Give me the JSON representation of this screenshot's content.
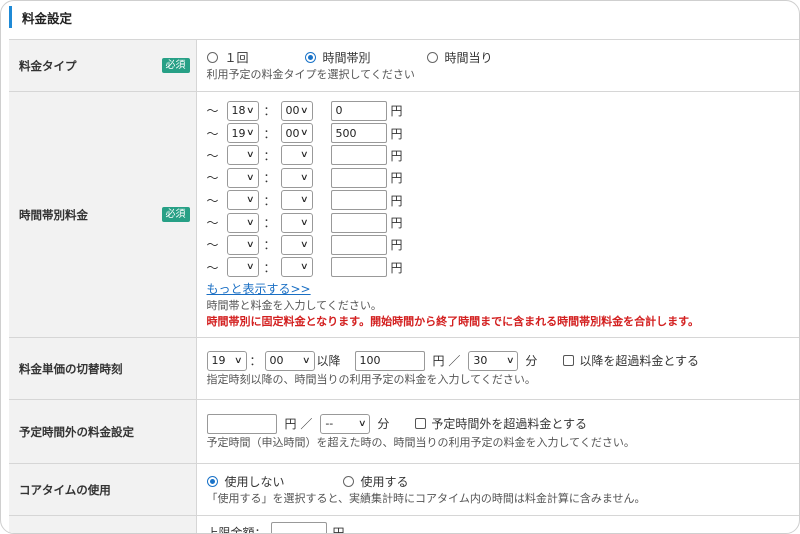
{
  "section": {
    "title": "料金設定"
  },
  "rows": {
    "fee_type": {
      "label": "料金タイプ",
      "required_badge": "必須",
      "options": [
        {
          "label": "１回",
          "checked": false
        },
        {
          "label": "時間帯別",
          "checked": true
        },
        {
          "label": "時間当り",
          "checked": false
        }
      ],
      "help": "利用予定の料金タイプを選択してください"
    },
    "time_band_fee": {
      "label": "時間帯別料金",
      "required_badge": "必須",
      "tilde": "〜",
      "colon": "：",
      "yen": "円",
      "bands": [
        {
          "hour": "18",
          "minute": "00",
          "amount": "0"
        },
        {
          "hour": "19",
          "minute": "00",
          "amount": "500"
        },
        {
          "hour": "",
          "minute": "",
          "amount": ""
        },
        {
          "hour": "",
          "minute": "",
          "amount": ""
        },
        {
          "hour": "",
          "minute": "",
          "amount": ""
        },
        {
          "hour": "",
          "minute": "",
          "amount": ""
        },
        {
          "hour": "",
          "minute": "",
          "amount": ""
        },
        {
          "hour": "",
          "minute": "",
          "amount": ""
        }
      ],
      "more_link": "もっと表示する>>",
      "help": "時間帯と料金を入力してください。",
      "warning": "時間帯別に固定料金となります。開始時間から終了時間までに含まれる時間帯別料金を合計します。"
    },
    "switch_time": {
      "label": "料金単価の切替時刻",
      "hour": "19",
      "minute": "00",
      "after_text": "以降",
      "amount": "100",
      "yen_per": "円 ／",
      "per_minutes": "30",
      "minute_unit": "分",
      "checkbox_label": "以降を超過料金とする",
      "help": "指定時刻以降の、時間当りの利用予定の料金を入力してください。"
    },
    "outside_fee": {
      "label": "予定時間外の料金設定",
      "amount": "",
      "yen_per": "円 ／",
      "per_minutes": "--",
      "minute_unit": "分",
      "checkbox_label": "予定時間外を超過料金とする",
      "help": "予定時間（申込時間）を超えた時の、時間当りの利用予定の料金を入力してください。"
    },
    "core_time": {
      "label": "コアタイムの使用",
      "options": [
        {
          "label": "使用しない",
          "checked": true
        },
        {
          "label": "使用する",
          "checked": false
        }
      ],
      "help": "「使用する」を選択すると、実績集計時にコアタイム内の時間は料金計算に含みません。"
    },
    "upper_limit": {
      "label": "上限金額：",
      "yen": "円"
    }
  }
}
